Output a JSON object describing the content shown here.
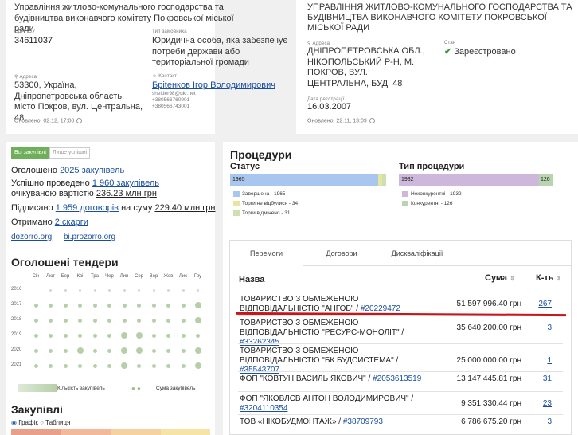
{
  "left_org": {
    "name": "Управління житлово-комунального господарства та будівництва виконавчого комітету Покровської міської ради",
    "edrpou_label": "ЄДРПОУ",
    "edrpou": "34611037",
    "type_label": "Тип замовника",
    "type_value": "Юридична особа, яка забезпечує потреби держави або територіальної громади",
    "address_label": "Адреса",
    "address": "53300, Україна, Дніпропетровська область, місто Покров, вул. Центральна, 48",
    "contact_label": "Контакт",
    "contact_name": "Бріtенков Ігор Володимирович",
    "contact_email": "shelder98@ukr.net",
    "contact_phone1": "+380566760901",
    "contact_phone2": "+380566743001",
    "updated": "Оновлено: 02.12, 17:00"
  },
  "right_org": {
    "name": "УПРАВЛІННЯ ЖИТЛОВО-КОМУНАЛЬНОГО ГОСПОДАРСТВА ТА БУДІВНИЦТВА ВИКОНАВЧОГО КОМІТЕТУ ПОКРОВСЬКОЇ МІСЬКОЇ РАДИ",
    "address_label": "Адреса",
    "address": "ДНІПРОПЕТРОВСЬКА ОБЛ., НІКОПОЛЬСЬКИЙ Р-Н, М. ПОКРОВ, ВУЛ. ЦЕНТРАЛЬНА, БУД. 48",
    "status_label": "Стан",
    "status_value": "Зареєстровано",
    "reg_date_label": "Дата реєстрації",
    "reg_date": "16.03.2007",
    "updated": "Оновлено: 22.11, 13:09"
  },
  "summary": {
    "toggle_all": "Всі закупівлі",
    "toggle_success": "Лише успішні",
    "announced_prefix": "Оголошено ",
    "announced_link": "2025 закупівель",
    "success_prefix": "Успішно проведено ",
    "success_link": "1 960 закупівель",
    "expected_prefix": "очікуваною вартістю ",
    "expected_value": "236.23 млн грн",
    "signed_prefix": "Підписано ",
    "signed_link": "1 959 договорів",
    "signed_mid": " на суму ",
    "signed_value": "229.40 млн грн",
    "complaints_prefix": "Отримано ",
    "complaints_link": "2 скарги",
    "link1": "dozorro.org",
    "link2": "bi.prozorro.org"
  },
  "tenders": {
    "title": "Оголошені тендери",
    "months": [
      "Січ",
      "Лют",
      "Бер",
      "Кві",
      "Тра",
      "Чер",
      "Лип",
      "Сер",
      "Вер",
      "Жов",
      "Лис",
      "Гру"
    ],
    "years": [
      "2016",
      "2017",
      "2018",
      "2019",
      "2020",
      "2021"
    ],
    "legend_count": "Кількість закупівель",
    "legend_sum": "Сума закупівель"
  },
  "purchases": {
    "title": "Закупівлі",
    "radio_chart": "Графік",
    "radio_table": "Таблиця"
  },
  "procedures": {
    "title": "Процедури",
    "status_title": "Статус",
    "status_bar_label": "1965",
    "status_legend": [
      "Завершена - 1965",
      "Торги не відбулися - 34",
      "Торги відмінено - 31"
    ],
    "status_colors": [
      "#a9c7ee",
      "#e6e6a0",
      "#cfe0b0"
    ],
    "type_title": "Тип процедури",
    "type_bar_label1": "1932",
    "type_bar_label2": "126",
    "type_legend": [
      "Неконкурентні - 1932",
      "Конкурентні - 126"
    ],
    "type_colors": [
      "#cdb8dc",
      "#b9d4b0"
    ]
  },
  "winners": {
    "tabs": [
      "Перемоги",
      "Договори",
      "Дискваліфікації"
    ],
    "col_name": "Назва",
    "col_sum": "Сума",
    "col_count": "К-ть",
    "rows": [
      {
        "name": "ТОВАРИСТВО З ОБМЕЖЕНОЮ ВІДПОВІДАЛЬНІСТЮ \"АНГОБ\" / ",
        "code": "#20229472",
        "sum": "51 597 996.40 грн",
        "count": "267"
      },
      {
        "name": "ТОВАРИСТВО З ОБМЕЖЕНОЮ ВІДПОВІДАЛЬНІСТЮ \"РЕСУРС-МОНОЛІТ\" / ",
        "code": "#33262345",
        "sum": "35 640 200.00 грн",
        "count": "3"
      },
      {
        "name": "ТОВАРИСТВО З ОБМЕЖЕНОЮ ВІДПОВІДАЛЬНІСТЮ \"БК БУДСИСТЕМА\" / ",
        "code": "#35543707",
        "sum": "25 000 000.00 грн",
        "count": "1"
      },
      {
        "name": "ФОП \"КОВТУН ВАСИЛЬ ЯКОВИЧ\" / ",
        "code": "#2053613519",
        "sum": "13 147 445.81 грн",
        "count": "31"
      },
      {
        "name": "ФОП \"ЯКОВЛЄВ АНТОН ВОЛОДИМИРОВИЧ\" / ",
        "code": "#3204110354",
        "sum": "9 351 330.44 грн",
        "count": "23"
      },
      {
        "name": "ТОВ «НІКОБУДМОНТАЖ» / ",
        "code": "#38709793",
        "sum": "6 786 675.20 грн",
        "count": "3"
      }
    ]
  }
}
